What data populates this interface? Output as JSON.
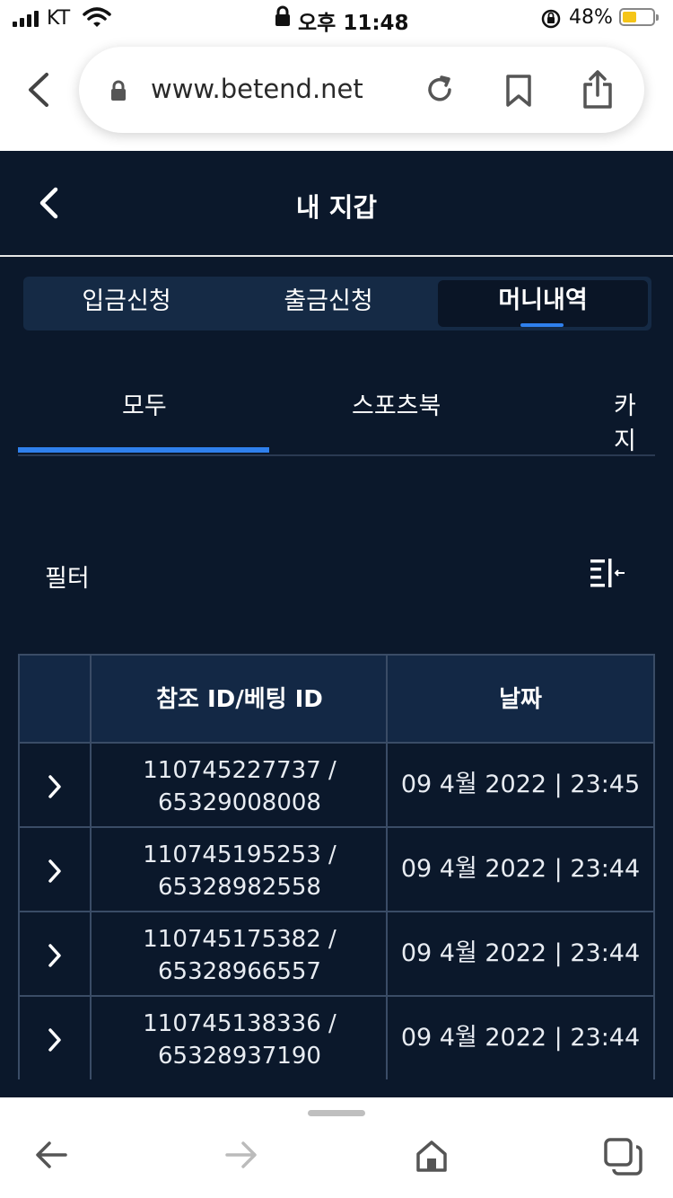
{
  "status_bar": {
    "carrier": "KT",
    "time": "오후 11:48",
    "battery": "48%",
    "battery_level": 0.48
  },
  "browser": {
    "url": "www.betend.net"
  },
  "header": {
    "title": "내 지갑"
  },
  "wallet_tabs": [
    {
      "label": "입금신청",
      "active": false
    },
    {
      "label": "출금신청",
      "active": false
    },
    {
      "label": "머니내역",
      "active": true
    }
  ],
  "sub_tabs": [
    {
      "label": "모두",
      "active": true
    },
    {
      "label": "스포츠북",
      "active": false
    },
    {
      "label": "카지",
      "active": false
    }
  ],
  "filter": {
    "label": "필터"
  },
  "table": {
    "headers": [
      "",
      "참조 ID/베팅 ID",
      "날짜"
    ],
    "rows": [
      {
        "ref_id": "110745227737 /",
        "bet_id": "65329008008",
        "date": "09 4월 2022 | 23:45"
      },
      {
        "ref_id": "110745195253 /",
        "bet_id": "65328982558",
        "date": "09 4월 2022 | 23:44"
      },
      {
        "ref_id": "110745175382 /",
        "bet_id": "65328966557",
        "date": "09 4월 2022 | 23:44"
      },
      {
        "ref_id": "110745138336 /",
        "bet_id": "65328937190",
        "date": "09 4월 2022 | 23:44"
      }
    ]
  },
  "colors": {
    "background": "#0b182b",
    "header_cell": "#132845",
    "accent": "#2f80ed",
    "border": "#3a4c66"
  }
}
